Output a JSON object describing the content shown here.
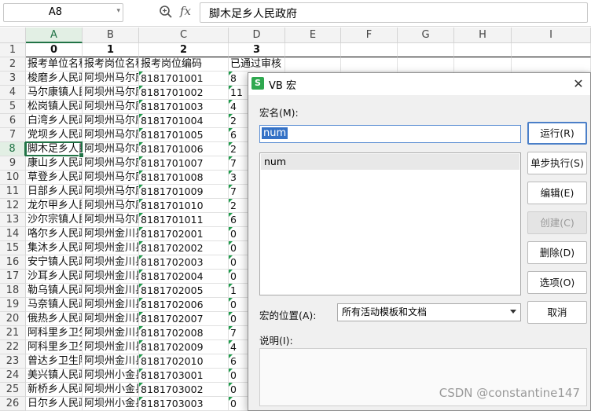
{
  "formula_bar": {
    "name_box": "A8",
    "fx_label": "fx",
    "content": "脚木足乡人民政府"
  },
  "sheet": {
    "columns": [
      "A",
      "B",
      "C",
      "D",
      "E",
      "F",
      "G",
      "H",
      "I"
    ],
    "selected_column": "A",
    "selected_row": "8",
    "rows": [
      {
        "n": "1",
        "a": "0",
        "b": "1",
        "c": "2",
        "d": "3"
      },
      {
        "n": "2",
        "a": "报考单位名称",
        "b": "报考岗位名称",
        "c": "报考岗位编码",
        "d": "已通过审核"
      },
      {
        "n": "3",
        "a": "梭磨乡人民政府",
        "b": "阿坝州马尔康市",
        "c": "8181701001",
        "d": "8"
      },
      {
        "n": "4",
        "a": "马尔康镇人民政府",
        "b": "阿坝州马尔康市",
        "c": "8181701002",
        "d": "11"
      },
      {
        "n": "5",
        "a": "松岗镇人民政府",
        "b": "阿坝州马尔康市",
        "c": "8181701003",
        "d": "4"
      },
      {
        "n": "6",
        "a": "白湾乡人民政府",
        "b": "阿坝州马尔康市",
        "c": "8181701004",
        "d": "2"
      },
      {
        "n": "7",
        "a": "党坝乡人民政府",
        "b": "阿坝州马尔康市",
        "c": "8181701005",
        "d": "6"
      },
      {
        "n": "8",
        "a": "脚木足乡人民政府",
        "b": "阿坝州马尔康市",
        "c": "8181701006",
        "d": "2"
      },
      {
        "n": "9",
        "a": "康山乡人民政府",
        "b": "阿坝州马尔康市",
        "c": "8181701007",
        "d": "7"
      },
      {
        "n": "10",
        "a": "草登乡人民政府",
        "b": "阿坝州马尔康市",
        "c": "8181701008",
        "d": "3"
      },
      {
        "n": "11",
        "a": "日部乡人民政府",
        "b": "阿坝州马尔康市",
        "c": "8181701009",
        "d": "7"
      },
      {
        "n": "12",
        "a": "龙尔甲乡人民政府",
        "b": "阿坝州马尔康市",
        "c": "8181701010",
        "d": "2"
      },
      {
        "n": "13",
        "a": "沙尔宗镇人民政府",
        "b": "阿坝州马尔康市",
        "c": "8181701011",
        "d": "6"
      },
      {
        "n": "14",
        "a": "咯尔乡人民政府",
        "b": "阿坝州金川县",
        "c": "8181702001",
        "d": "0"
      },
      {
        "n": "15",
        "a": "集沐乡人民政府",
        "b": "阿坝州金川县",
        "c": "8181702002",
        "d": "0"
      },
      {
        "n": "16",
        "a": "安宁镇人民政府",
        "b": "阿坝州金川县",
        "c": "8181702003",
        "d": "0"
      },
      {
        "n": "17",
        "a": "沙耳乡人民政府",
        "b": "阿坝州金川县",
        "c": "8181702004",
        "d": "0"
      },
      {
        "n": "18",
        "a": "勒乌镇人民政府",
        "b": "阿坝州金川县",
        "c": "8181702005",
        "d": "1"
      },
      {
        "n": "19",
        "a": "马奈镇人民政府",
        "b": "阿坝州金川县",
        "c": "8181702006",
        "d": "0"
      },
      {
        "n": "20",
        "a": "俄热乡人民政府",
        "b": "阿坝州金川县",
        "c": "8181702007",
        "d": "0"
      },
      {
        "n": "21",
        "a": "阿科里乡卫生院",
        "b": "阿坝州金川县",
        "c": "8181702008",
        "d": "7"
      },
      {
        "n": "22",
        "a": "阿科里乡卫生院",
        "b": "阿坝州金川县",
        "c": "8181702009",
        "d": "4"
      },
      {
        "n": "23",
        "a": "曾达乡卫生院",
        "b": "阿坝州金川县",
        "c": "8181702010",
        "d": "6"
      },
      {
        "n": "24",
        "a": "美兴镇人民政府",
        "b": "阿坝州小金县",
        "c": "8181703001",
        "d": "0"
      },
      {
        "n": "25",
        "a": "新桥乡人民政府",
        "b": "阿坝州小金县",
        "c": "8181703002",
        "d": "0"
      },
      {
        "n": "26",
        "a": "日尔乡人民政府",
        "b": "阿坝州小金县",
        "c": "8181703003",
        "d": "0"
      }
    ]
  },
  "dialog": {
    "logo": "S",
    "title": "VB 宏",
    "close": "✕",
    "macro_name_label": "宏名(M):",
    "macro_name_value": "num",
    "macro_list": [
      "num"
    ],
    "buttons": {
      "run": "运行(R)",
      "step": "单步执行(S)",
      "edit": "编辑(E)",
      "create": "创建(C)",
      "delete": "删除(D)",
      "options": "选项(O)",
      "cancel": "取消"
    },
    "location_label": "宏的位置(A):",
    "location_value": "所有活动模板和文档",
    "description_label": "说明(I):"
  },
  "watermark": "CSDN @constantine147"
}
